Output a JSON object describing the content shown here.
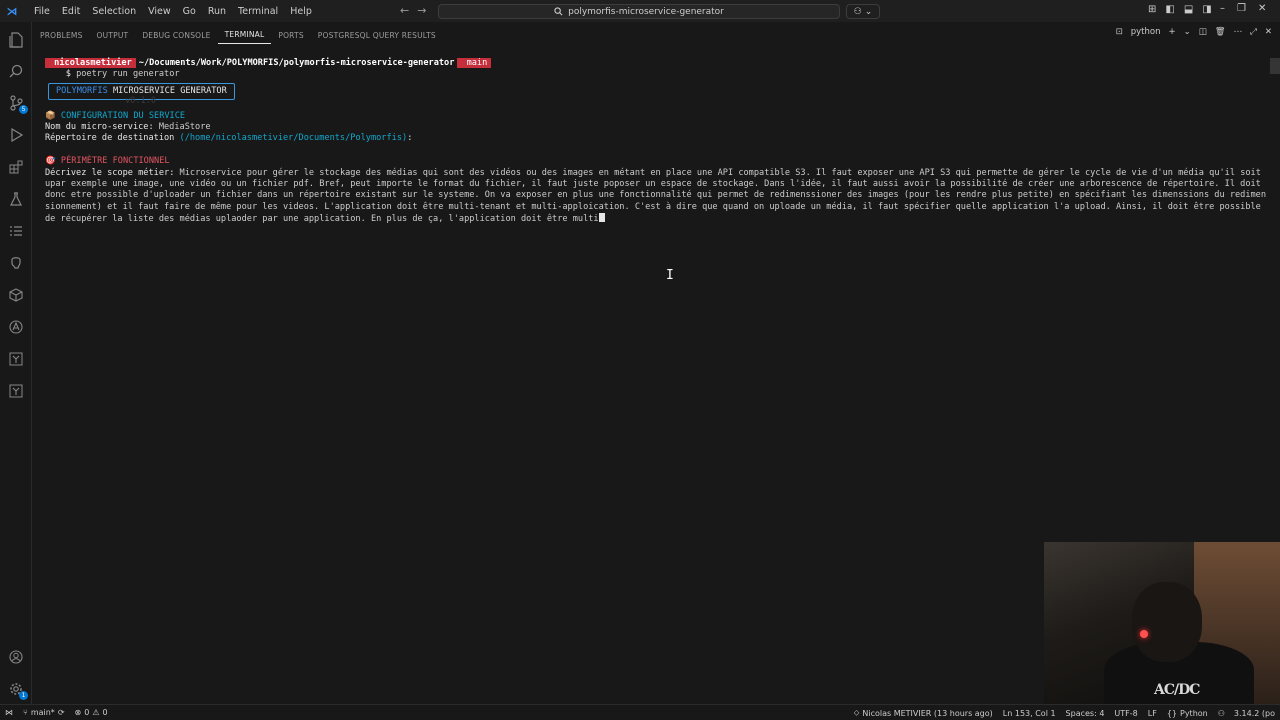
{
  "titlebar": {
    "logo": "⋊",
    "menu": [
      "File",
      "Edit",
      "Selection",
      "View",
      "Go",
      "Run",
      "Terminal",
      "Help"
    ],
    "search_text": "polymorfis-microservice-generator"
  },
  "activity_bar": {
    "scm_badge": "5",
    "settings_badge": "1"
  },
  "panel": {
    "tabs": [
      "PROBLEMS",
      "OUTPUT",
      "DEBUG CONSOLE",
      "TERMINAL",
      "PORTS",
      "POSTGRESQL QUERY RESULTS"
    ],
    "active_tab": "TERMINAL",
    "terminal_name": "python"
  },
  "terminal": {
    "prompt_user": " nicolasmetivier",
    "prompt_path": "~/Documents/Work/POLYMORFIS/polymorfis-microservice-generator",
    "prompt_branch": " main",
    "command_prefix": "$",
    "command": "poetry run generator",
    "banner_word1": "POLYMORFIS",
    "banner_word2": "MICROSERVICE GENERATOR",
    "version": "v0.1.0",
    "section1_icon": "📦",
    "section1_title": "CONFIGURATION DU SERVICE",
    "service_name_label": "Nom du micro-service: ",
    "service_name_value": "MediaStore",
    "dest_label": "Répertoire de destination ",
    "dest_value": "(/home/nicolasmetivier/Documents/Polymorfis)",
    "dest_suffix": ":",
    "section2_icon": "🎯",
    "section2_title": "PÉRIMÈTRE FONCTIONNEL",
    "scope_label": "Décrivez le scope métier",
    "scope_colon": ":",
    "scope_text": " Microservice pour gérer le stockage des médias qui sont des vidéos ou des images en métant en place une API compatible S3. Il faut exposer une API S3 qui permette de gérer le cycle de vie d'un média qu'il soit upar exemple une image, une vidéo ou un fichier pdf. Bref, peut importe le format du fichier, il faut juste poposer un espace de stockage. Dans l'idée, il faut aussi avoir la possibilité de créer une arborescence de répertoire. Il doit donc etre possible d'uploader un fichier dans un répertoire existant sur le systeme. On va exposer en plus une fonctionnalité qui permet de redimenssioner des images (pour les rendre plus petite) en spécifiant les dimenssions du redimensionnement) et il faut faire de même pour les videos. L'application doit être multi-tenant et multi-apploication. C'est à dire que quand on uploade un média, il faut spécifier quelle application l'a upload. Ainsi, il doit être possible de récupérer la liste des médias uplaoder par une application. En plus de ça, l'application doit être multi"
  },
  "statusbar": {
    "branch": "main*",
    "errors": "0",
    "warnings": "0",
    "author": "Nicolas METIVIER (13 hours ago)",
    "position": "Ln 153, Col 1",
    "spaces": "Spaces: 4",
    "encoding": "UTF-8",
    "eol": "LF",
    "language": "Python",
    "python_version": "3.14.2 (po"
  },
  "webcam": {
    "shirt_text": "AC/DC"
  }
}
